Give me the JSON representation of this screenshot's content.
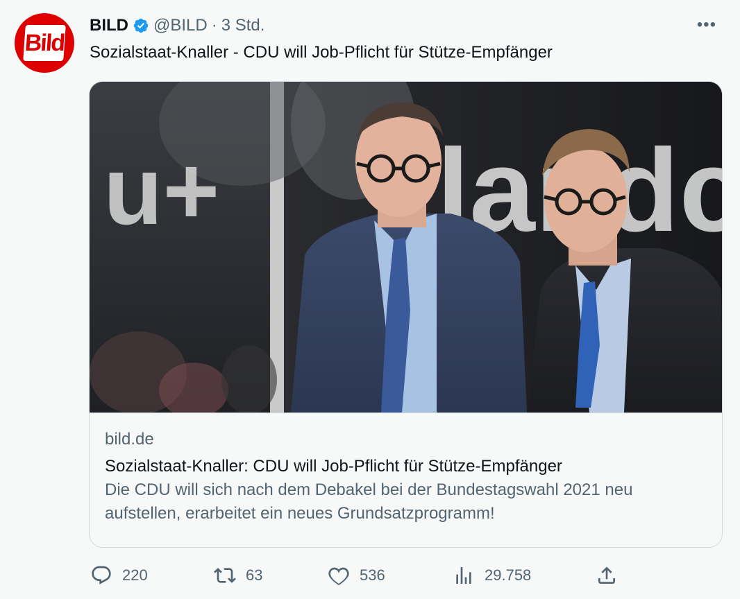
{
  "account": {
    "name": "BILD",
    "handle": "@BILD",
    "separator": "·",
    "time": "3 Std.",
    "avatar_logo": "Bild",
    "verified_icon": "verified-badge-icon"
  },
  "tweet": {
    "text": "Sozialstaat-Knaller - CDU will Job-Pflicht für Stütze-Empfänger",
    "more_label": "•••"
  },
  "card": {
    "domain": "bild.de",
    "title": "Sozialstaat-Knaller: CDU will Job-Pflicht für Stütze-Empfänger",
    "description": "Die CDU will sich nach dem Debakel bei der Bundestagswahl 2021 neu aufstellen, erarbeitet ein neues Grundsatzprogramm!",
    "image_background_text": "landc"
  },
  "actions": {
    "replies": "220",
    "retweets": "63",
    "likes": "536",
    "views": "29.758"
  },
  "colors": {
    "accent": "#1d9bf0",
    "brand_red": "#dd0000",
    "text_primary": "#0f1419",
    "text_secondary": "#536471",
    "border": "#cfd9de",
    "background": "#f7f9f9"
  }
}
